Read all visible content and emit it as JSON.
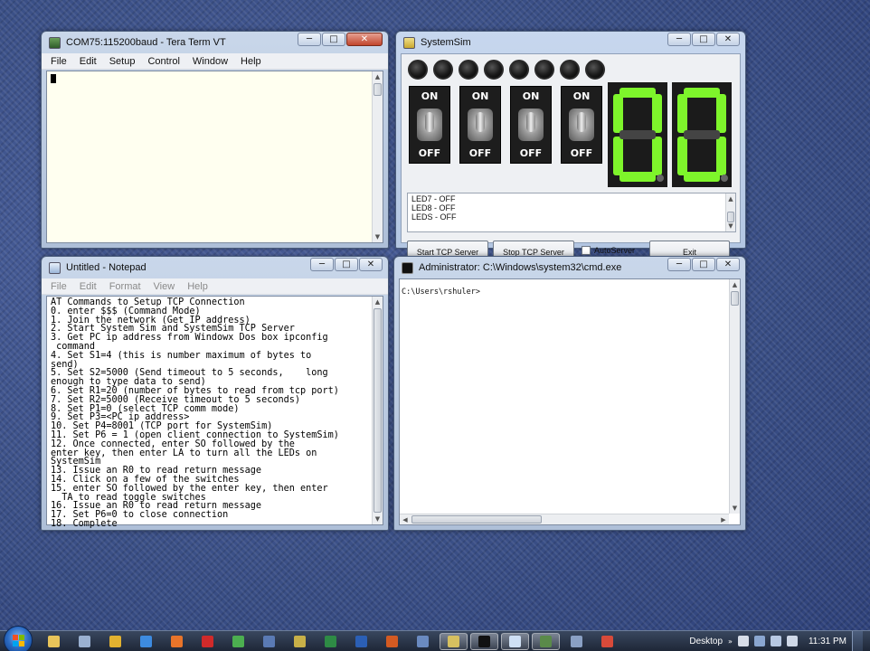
{
  "teraterm": {
    "title": "COM75:115200baud - Tera Term VT",
    "menu": [
      "File",
      "Edit",
      "Setup",
      "Control",
      "Window",
      "Help"
    ]
  },
  "systemsim": {
    "title": "SystemSim",
    "leds_lit": [
      false,
      false,
      false,
      false,
      false,
      false,
      false,
      false
    ],
    "switches": [
      {
        "on": "ON",
        "off": "OFF"
      },
      {
        "on": "ON",
        "off": "OFF"
      },
      {
        "on": "ON",
        "off": "OFF"
      },
      {
        "on": "ON",
        "off": "OFF"
      }
    ],
    "display_digits": "00",
    "segment_color": "#7ef52b",
    "log_lines": [
      "LED7 - OFF",
      "LED8 - OFF",
      "LEDS - OFF"
    ],
    "start_tcp_label": "Start TCP Server",
    "stop_tcp_label": "Stop TCP Server",
    "autoserver_label": "AutoServer",
    "autoserver_checked": false,
    "exit_label": "Exit"
  },
  "notepad": {
    "title": "Untitled - Notepad",
    "menu": [
      "File",
      "Edit",
      "Format",
      "View",
      "Help"
    ],
    "lines": [
      "AT Commands to Setup TCP Connection",
      "0. enter $$$ (Command Mode)",
      "1. Join the network (Get IP address)",
      "2. Start System Sim and SystemSim TCP Server",
      "3. Get PC ip address from Windowx Dos box ipconfig",
      " command",
      "4. Set S1=4 (this is number maximum of bytes to",
      "send)",
      "5. Set S2=5000 (Send timeout to 5 seconds,    long",
      "enough to type data to send)",
      "6. Set R1=20 (number of bytes to read from tcp port)",
      "7. Set R2=5000 (Receive timeout to 5 seconds)",
      "8. Set P1=0 (select TCP comm mode)",
      "9. Set P3=<PC ip address>",
      "10. Set P4=8001 (TCP port for SystemSim)",
      "11. Set P6 = 1 (open client connection to SystemSim)",
      "12. Once connected, enter SO followed by the",
      "enter key, then enter LA to turn all the LEDs on",
      "SystemSim",
      "13. Issue an R0 to read return message",
      "14. Click on a few of the switches",
      "15. enter SO followed by the enter key, then enter",
      "  TA to read toggle switches",
      "16. Issue an R0 to read return message",
      "17. Set P6=0 to close connection",
      "18. Complete"
    ]
  },
  "cmd": {
    "title": "Administrator: C:\\Windows\\system32\\cmd.exe",
    "prompt": "C:\\Users\\rshuler>"
  },
  "taskbar": {
    "desktop_label": "Desktop",
    "clock": "11:31 PM",
    "apps": [
      {
        "icon": "explorer-icon",
        "color": "#e8c45a"
      },
      {
        "icon": "tool-icon",
        "color": "#9ab0d0"
      },
      {
        "icon": "outlook-icon",
        "color": "#e2b230"
      },
      {
        "icon": "ie-icon",
        "color": "#3d8be0"
      },
      {
        "icon": "firefox-icon",
        "color": "#e8742a"
      },
      {
        "icon": "opera-icon",
        "color": "#d02a2a"
      },
      {
        "icon": "chrome-icon",
        "color": "#4caf50"
      },
      {
        "icon": "media-icon",
        "color": "#5a7ab4"
      },
      {
        "icon": "tool2-icon",
        "color": "#c8b048"
      },
      {
        "icon": "excel-icon",
        "color": "#2e8b45"
      },
      {
        "icon": "word-icon",
        "color": "#2b5fb5"
      },
      {
        "icon": "powerpoint-icon",
        "color": "#d35a22"
      },
      {
        "icon": "network-icon",
        "color": "#6a8ac0"
      },
      {
        "icon": "systemsim-icon",
        "color": "#d6c060"
      },
      {
        "icon": "cmd-icon",
        "color": "#111111"
      },
      {
        "icon": "notepad-icon",
        "color": "#cfe0f4"
      },
      {
        "icon": "teraterm-icon",
        "color": "#5a8a4a"
      },
      {
        "icon": "settings-icon",
        "color": "#8aa0c4"
      },
      {
        "icon": "snip-icon",
        "color": "#d84a3a"
      }
    ],
    "active_apps": [
      13,
      14,
      15,
      16
    ]
  }
}
